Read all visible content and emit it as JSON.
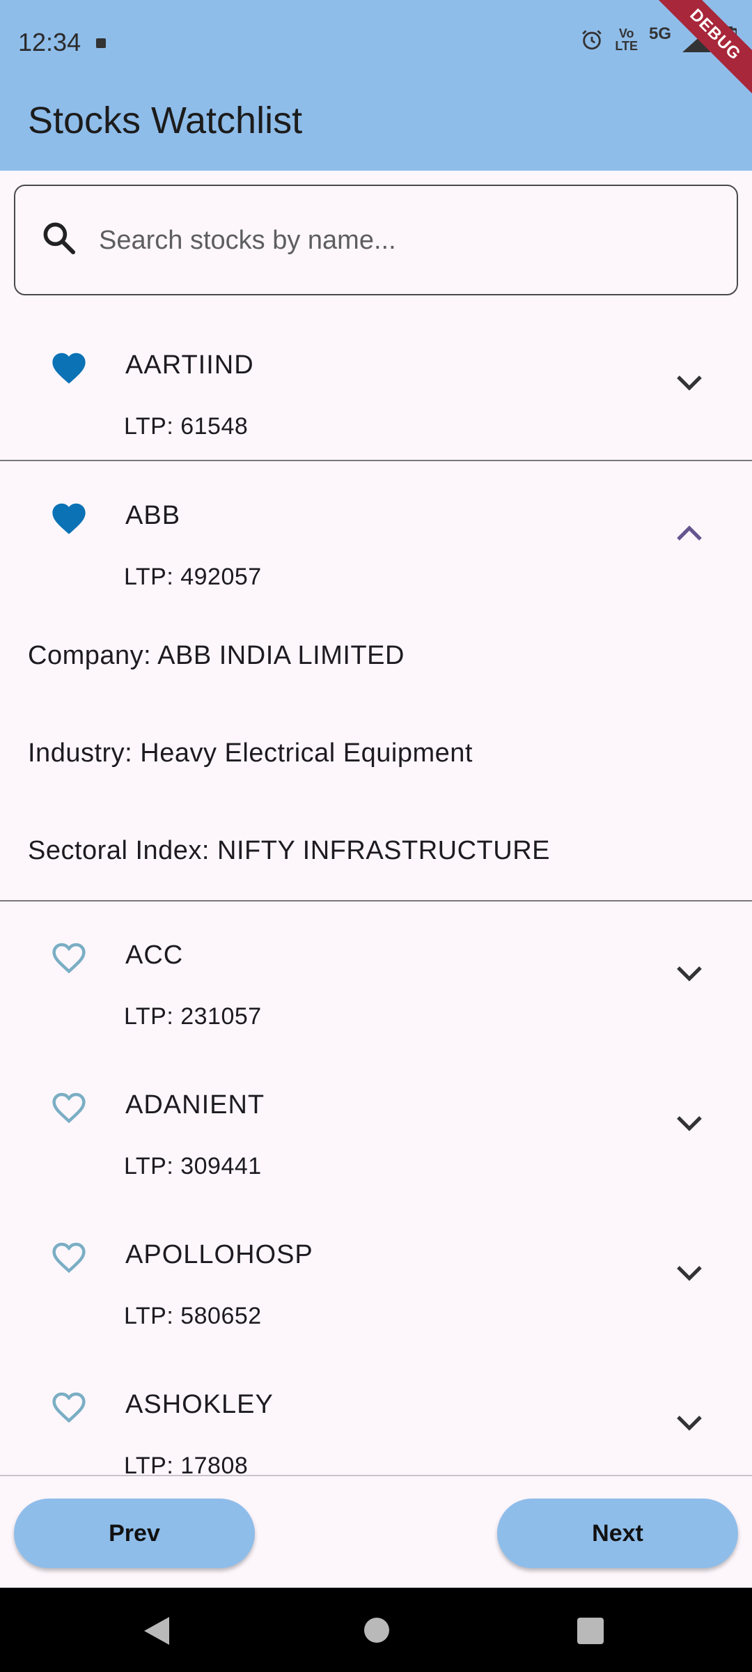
{
  "status_bar": {
    "time": "12:34",
    "lte_label_top": "Vo",
    "lte_label_bottom": "LTE",
    "network": "5G",
    "debug_banner": "DEBUG"
  },
  "app_bar": {
    "title": "Stocks Watchlist"
  },
  "search": {
    "placeholder": "Search stocks by name...",
    "value": ""
  },
  "stocks": [
    {
      "symbol": "AARTIIND",
      "ltp": "LTP: 61548",
      "favorite": true,
      "expanded": false
    },
    {
      "symbol": "ABB",
      "ltp": "LTP: 492057",
      "favorite": true,
      "expanded": true,
      "company": "Company: ABB INDIA LIMITED",
      "industry": "Industry: Heavy Electrical Equipment",
      "sectoral_index": "Sectoral Index: NIFTY INFRASTRUCTURE"
    },
    {
      "symbol": "ACC",
      "ltp": "LTP: 231057",
      "favorite": false,
      "expanded": false
    },
    {
      "symbol": "ADANIENT",
      "ltp": "LTP: 309441",
      "favorite": false,
      "expanded": false
    },
    {
      "symbol": "APOLLOHOSP",
      "ltp": "LTP: 580652",
      "favorite": false,
      "expanded": false
    },
    {
      "symbol": "ASHOKLEY",
      "ltp": "LTP: 17808",
      "favorite": false,
      "expanded": false
    }
  ],
  "pagination": {
    "prev_label": "Prev",
    "next_label": "Next"
  },
  "colors": {
    "app_bar": "#8fbdea",
    "favorite_filled": "#0a72b5",
    "favorite_outline": "#7aaec4",
    "expanded_chevron": "#65558f",
    "background": "#fdf7fc"
  },
  "icons": {
    "search": "search-icon",
    "favorite": "heart-filled-icon",
    "not_favorite": "heart-outline-icon",
    "expand": "chevron-down-icon",
    "collapse": "chevron-up-icon"
  }
}
